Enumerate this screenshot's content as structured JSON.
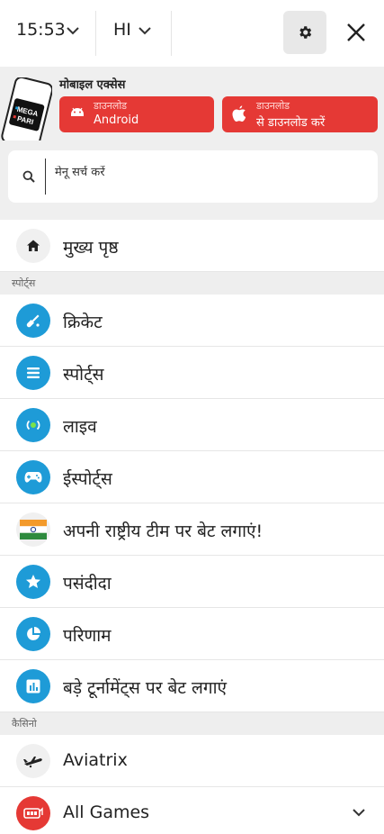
{
  "header": {
    "time": "15:53",
    "language": "HI"
  },
  "mobile": {
    "title": "मोबाइल एक्सेस",
    "phone_logo": "MEGA PARI",
    "android": {
      "small": "डाउनलोड",
      "big": "Android"
    },
    "ios": {
      "small": "डाउनलोड",
      "big": "से डाउनलोड करें"
    }
  },
  "search": {
    "placeholder": "मेनू सर्च करें"
  },
  "menu": {
    "home": "मुख्य पृष्ठ",
    "sports_section": "स्पोर्ट्स",
    "sports_items": [
      {
        "label": "क्रिकेट",
        "icon": "cricket-bat-icon"
      },
      {
        "label": "स्पोर्ट्स",
        "icon": "list-icon"
      },
      {
        "label": "लाइव",
        "icon": "live-broadcast-icon"
      },
      {
        "label": "ईस्पोर्ट्स",
        "icon": "gamepad-icon"
      },
      {
        "label": "अपनी राष्ट्रीय टीम पर बेट लगाएं!",
        "icon": "india-flag-icon"
      },
      {
        "label": "पसंदीदा",
        "icon": "star-icon"
      },
      {
        "label": "परिणाम",
        "icon": "pie-chart-icon"
      },
      {
        "label": "बड़े टूर्नामेंट्स पर बेट लगाएं",
        "icon": "bar-chart-icon"
      }
    ],
    "casino_section": "कैसिनो",
    "casino_items": [
      {
        "label": "Aviatrix",
        "icon": "airplane-icon"
      },
      {
        "label": "All Games",
        "icon": "slot-machine-icon"
      }
    ]
  },
  "colors": {
    "accent_blue": "#1e9bd7",
    "download_red": "#e53935",
    "band_grey": "#efefef"
  }
}
